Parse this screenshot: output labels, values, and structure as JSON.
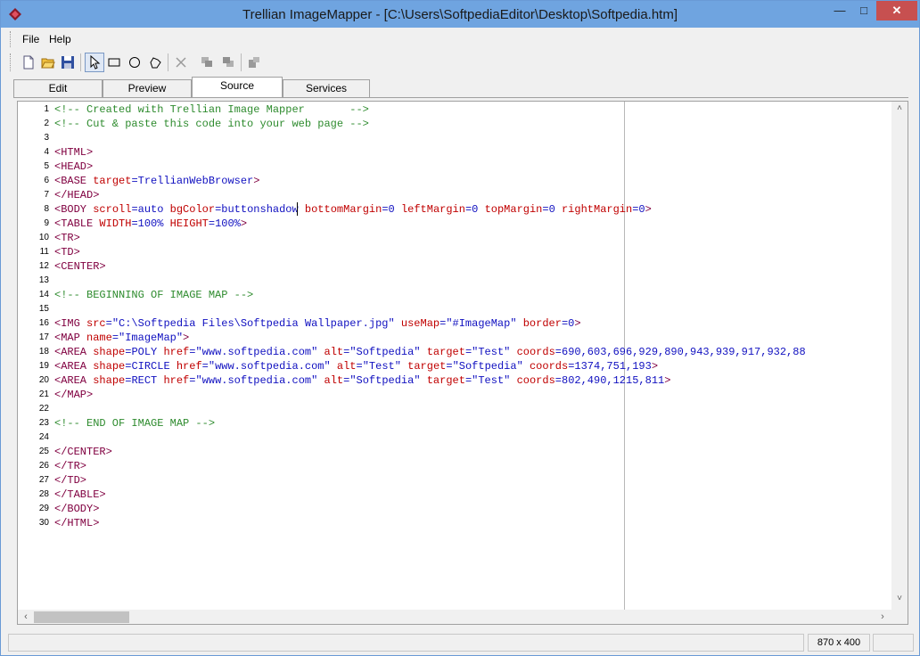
{
  "window": {
    "title": "Trellian ImageMapper - [C:\\Users\\SoftpediaEditor\\Desktop\\Softpedia.htm]",
    "minimize": "—",
    "maximize": "□",
    "close": "✕"
  },
  "menu": {
    "file": "File",
    "help": "Help"
  },
  "toolbar": {
    "icons": [
      "new-file-icon",
      "open-folder-icon",
      "save-icon",
      "pointer-icon",
      "rectangle-icon",
      "circle-icon",
      "polygon-icon",
      "delete-icon",
      "bring-forward-icon",
      "send-backward-icon",
      "properties-icon"
    ]
  },
  "tabs": {
    "edit": "Edit",
    "preview": "Preview",
    "source": "Source",
    "services": "Services"
  },
  "editor": {
    "lines": [
      {
        "n": "1",
        "parts": [
          [
            "cm",
            "<!-- Created with Trellian Image Mapper       -->"
          ]
        ]
      },
      {
        "n": "2",
        "parts": [
          [
            "cm",
            "<!-- Cut & paste this code into your web page -->"
          ]
        ]
      },
      {
        "n": "3",
        "parts": []
      },
      {
        "n": "4",
        "parts": [
          [
            "tg",
            "<HTML>"
          ]
        ]
      },
      {
        "n": "5",
        "parts": [
          [
            "tg",
            "<HEAD>"
          ]
        ]
      },
      {
        "n": "6",
        "parts": [
          [
            "tg",
            "<BASE "
          ],
          [
            "at",
            "target"
          ],
          [
            "op",
            "="
          ],
          [
            "vl",
            "TrellianWebBrowser"
          ],
          [
            "tg",
            ">"
          ]
        ]
      },
      {
        "n": "7",
        "parts": [
          [
            "tg",
            "</HEAD>"
          ]
        ]
      },
      {
        "n": "8",
        "parts": [
          [
            "tg",
            "<BODY "
          ],
          [
            "at",
            "scroll"
          ],
          [
            "op",
            "="
          ],
          [
            "vl",
            "auto "
          ],
          [
            "at",
            "bgColor"
          ],
          [
            "op",
            "="
          ],
          [
            "vl",
            "buttonshadow "
          ],
          [
            "at",
            "bottomMargin"
          ],
          [
            "op",
            "="
          ],
          [
            "vl",
            "0 "
          ],
          [
            "at",
            "leftMargin"
          ],
          [
            "op",
            "="
          ],
          [
            "vl",
            "0 "
          ],
          [
            "at",
            "topMargin"
          ],
          [
            "op",
            "="
          ],
          [
            "vl",
            "0 "
          ],
          [
            "at",
            "rightMargin"
          ],
          [
            "op",
            "="
          ],
          [
            "vl",
            "0"
          ],
          [
            "tg",
            ">"
          ]
        ]
      },
      {
        "n": "9",
        "parts": [
          [
            "tg",
            "<TABLE "
          ],
          [
            "at",
            "WIDTH"
          ],
          [
            "op",
            "="
          ],
          [
            "vl",
            "100% "
          ],
          [
            "at",
            "HEIGHT"
          ],
          [
            "op",
            "="
          ],
          [
            "vl",
            "100%"
          ],
          [
            "tg",
            ">"
          ]
        ]
      },
      {
        "n": "10",
        "parts": [
          [
            "tg",
            "<TR>"
          ]
        ]
      },
      {
        "n": "11",
        "parts": [
          [
            "tg",
            "<TD>"
          ]
        ]
      },
      {
        "n": "12",
        "parts": [
          [
            "tg",
            "<CENTER>"
          ]
        ]
      },
      {
        "n": "13",
        "parts": []
      },
      {
        "n": "14",
        "parts": [
          [
            "cm",
            "<!-- BEGINNING OF IMAGE MAP -->"
          ]
        ]
      },
      {
        "n": "15",
        "parts": []
      },
      {
        "n": "16",
        "parts": [
          [
            "tg",
            "<IMG "
          ],
          [
            "at",
            "src"
          ],
          [
            "op",
            "="
          ],
          [
            "vl",
            "\"C:\\Softpedia Files\\Softpedia Wallpaper.jpg\" "
          ],
          [
            "at",
            "useMap"
          ],
          [
            "op",
            "="
          ],
          [
            "vl",
            "\"#ImageMap\" "
          ],
          [
            "at",
            "border"
          ],
          [
            "op",
            "="
          ],
          [
            "vl",
            "0"
          ],
          [
            "tg",
            ">"
          ]
        ]
      },
      {
        "n": "17",
        "parts": [
          [
            "tg",
            "<MAP "
          ],
          [
            "at",
            "name"
          ],
          [
            "op",
            "="
          ],
          [
            "vl",
            "\"ImageMap\""
          ],
          [
            "tg",
            ">"
          ]
        ]
      },
      {
        "n": "18",
        "parts": [
          [
            "tg",
            "<AREA "
          ],
          [
            "at",
            "shape"
          ],
          [
            "op",
            "="
          ],
          [
            "vl",
            "POLY "
          ],
          [
            "at",
            "href"
          ],
          [
            "op",
            "="
          ],
          [
            "vl",
            "\"www.softpedia.com\" "
          ],
          [
            "at",
            "alt"
          ],
          [
            "op",
            "="
          ],
          [
            "vl",
            "\"Softpedia\" "
          ],
          [
            "at",
            "target"
          ],
          [
            "op",
            "="
          ],
          [
            "vl",
            "\"Test\" "
          ],
          [
            "at",
            "coords"
          ],
          [
            "op",
            "="
          ],
          [
            "vl",
            "690,603,696,929,890,943,939,917,932,88"
          ]
        ]
      },
      {
        "n": "19",
        "parts": [
          [
            "tg",
            "<AREA "
          ],
          [
            "at",
            "shape"
          ],
          [
            "op",
            "="
          ],
          [
            "vl",
            "CIRCLE "
          ],
          [
            "at",
            "href"
          ],
          [
            "op",
            "="
          ],
          [
            "vl",
            "\"www.softpedia.com\" "
          ],
          [
            "at",
            "alt"
          ],
          [
            "op",
            "="
          ],
          [
            "vl",
            "\"Test\" "
          ],
          [
            "at",
            "target"
          ],
          [
            "op",
            "="
          ],
          [
            "vl",
            "\"Softpedia\" "
          ],
          [
            "at",
            "coords"
          ],
          [
            "op",
            "="
          ],
          [
            "vl",
            "1374,751,193"
          ],
          [
            "tg",
            ">"
          ]
        ]
      },
      {
        "n": "20",
        "parts": [
          [
            "tg",
            "<AREA "
          ],
          [
            "at",
            "shape"
          ],
          [
            "op",
            "="
          ],
          [
            "vl",
            "RECT "
          ],
          [
            "at",
            "href"
          ],
          [
            "op",
            "="
          ],
          [
            "vl",
            "\"www.softpedia.com\" "
          ],
          [
            "at",
            "alt"
          ],
          [
            "op",
            "="
          ],
          [
            "vl",
            "\"Softpedia\" "
          ],
          [
            "at",
            "target"
          ],
          [
            "op",
            "="
          ],
          [
            "vl",
            "\"Test\" "
          ],
          [
            "at",
            "coords"
          ],
          [
            "op",
            "="
          ],
          [
            "vl",
            "802,490,1215,811"
          ],
          [
            "tg",
            ">"
          ]
        ]
      },
      {
        "n": "21",
        "parts": [
          [
            "tg",
            "</MAP>"
          ]
        ]
      },
      {
        "n": "22",
        "parts": []
      },
      {
        "n": "23",
        "parts": [
          [
            "cm",
            "<!-- END OF IMAGE MAP -->"
          ]
        ]
      },
      {
        "n": "24",
        "parts": []
      },
      {
        "n": "25",
        "parts": [
          [
            "tg",
            "</CENTER>"
          ]
        ]
      },
      {
        "n": "26",
        "parts": [
          [
            "tg",
            "</TR>"
          ]
        ]
      },
      {
        "n": "27",
        "parts": [
          [
            "tg",
            "</TD>"
          ]
        ]
      },
      {
        "n": "28",
        "parts": [
          [
            "tg",
            "</TABLE>"
          ]
        ]
      },
      {
        "n": "29",
        "parts": [
          [
            "tg",
            "</BODY>"
          ]
        ]
      },
      {
        "n": "30",
        "parts": [
          [
            "tg",
            "</HTML>"
          ]
        ]
      }
    ]
  },
  "scroll": {
    "up": "˄",
    "down": "˅",
    "left": "‹",
    "right": "›"
  },
  "status": {
    "image_size": "870 x 400"
  }
}
